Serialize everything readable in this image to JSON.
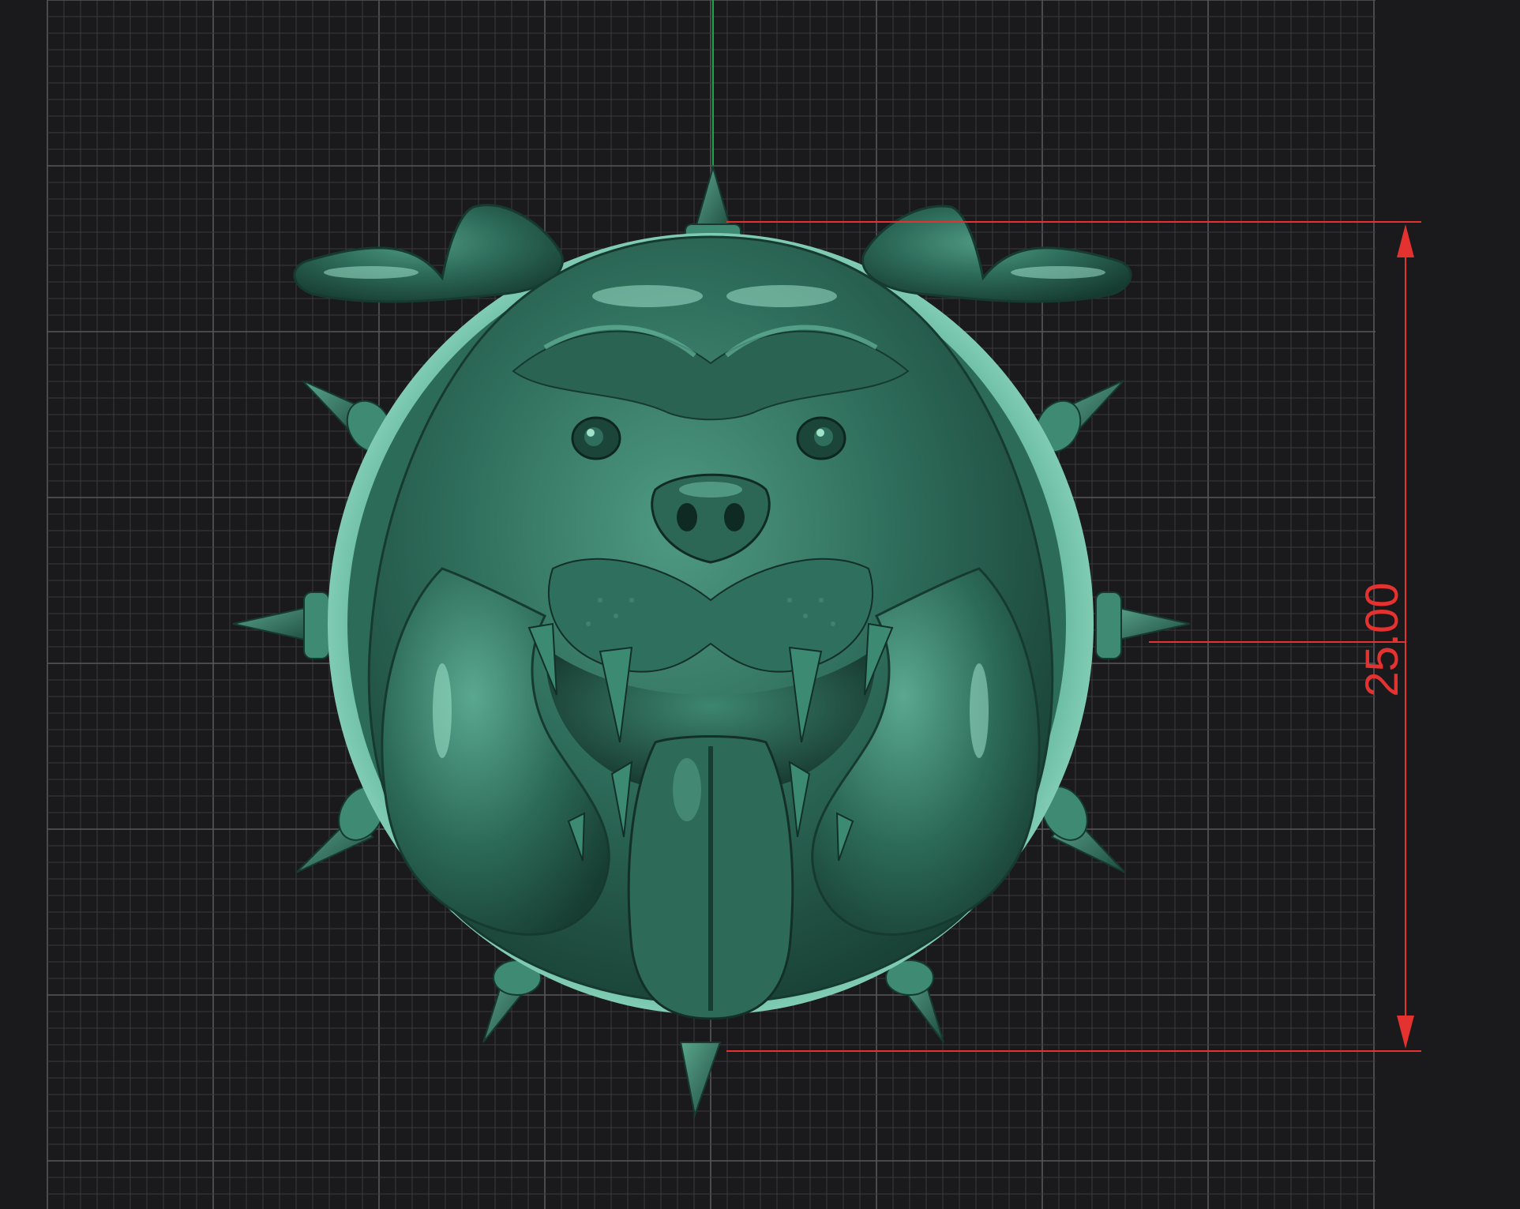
{
  "viewport": {
    "background": "#1a1a1c",
    "grid_minor_color": "#3a3a3e",
    "grid_major_color": "#57575c",
    "axis_y_color": "#1aa84a"
  },
  "model": {
    "name_icon": "bulldog-head-icon",
    "color": "#2f6e5c",
    "highlight": "#7fd4b8",
    "shadow": "#173b30"
  },
  "dimension": {
    "value": "25.00",
    "color": "#e3322f"
  }
}
